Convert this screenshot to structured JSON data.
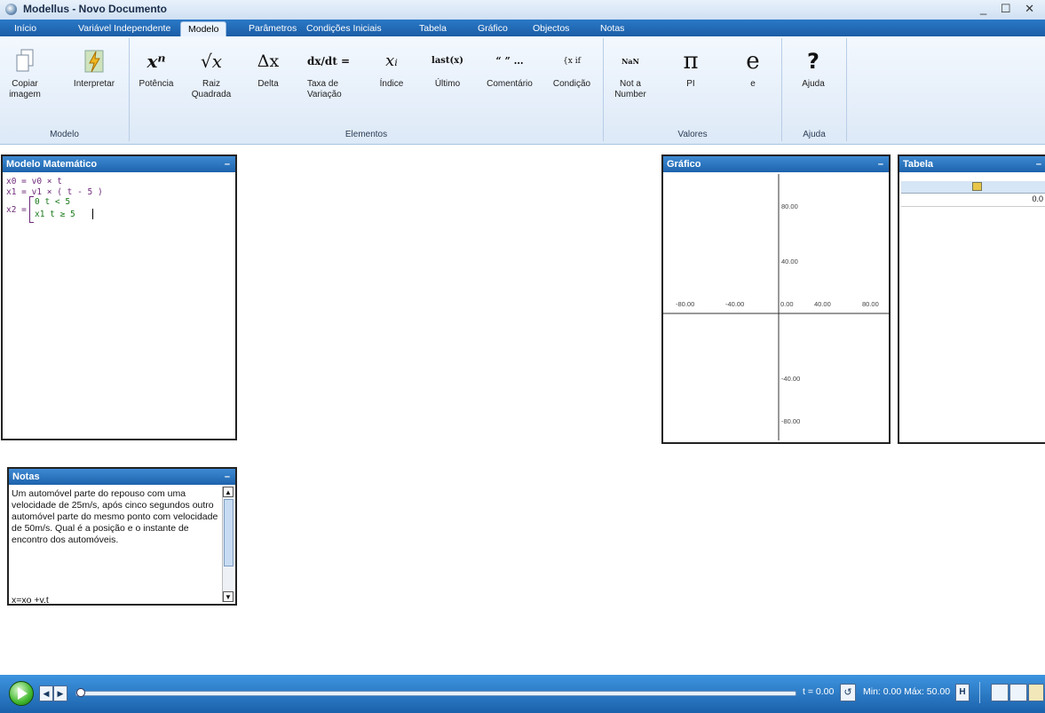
{
  "window": {
    "title": "Modellus - Novo Documento",
    "controls": "_ ☐ ✕"
  },
  "tabs": [
    "Início",
    "Variável Independente",
    "Modelo",
    "Parâmetros",
    "Condições Iniciais",
    "Tabela",
    "Gráfico",
    "Objectos",
    "Notas"
  ],
  "ribbon": {
    "modelo": {
      "label": "Modelo",
      "copiar": "Copiar imagem",
      "interpretar": "Interpretar"
    },
    "elementos": {
      "label": "Elementos",
      "potencia": "Potência",
      "raiz": "Raiz Quadrada",
      "delta": "Delta",
      "taxa": "Taxa de Variação",
      "indice": "Índice",
      "ultimo": "Último",
      "comentario": "Comentário",
      "condicao": "Condição",
      "potencia_sym": "xⁿ",
      "raiz_sym": "√x",
      "delta_sym": "Δx",
      "taxa_sym": "dx/dt =",
      "indice_sym": "xᵢ",
      "ultimo_sym": "last(x)",
      "comentario_sym": "“ ” …",
      "condicao_sym": "{x if"
    },
    "valores": {
      "label": "Valores",
      "nan": "Not a Number",
      "nan_sym": "NaN",
      "pi": "PI",
      "pi_sym": "π",
      "e": "e",
      "e_sym": "e"
    },
    "ajuda": {
      "label": "Ajuda",
      "ajuda": "Ajuda",
      "ajuda_sym": "?"
    }
  },
  "modelo_panel": {
    "title": "Modelo Matemático",
    "eq1": "x0 = v0 × t",
    "eq2": "x1 = v1 × ( t - 5 )",
    "eq3_lhs": "x2 =",
    "eq3_case1": "0  t < 5",
    "eq3_case2": "x1  t ≥ 5"
  },
  "grafico_panel": {
    "title": "Gráfico",
    "x_ticks": [
      "-80.00",
      "-40.00",
      "0.00",
      "40.00",
      "80.00"
    ],
    "y_ticks": [
      "80.00",
      "40.00",
      "-40.00",
      "-80.00"
    ]
  },
  "tabela_panel": {
    "title": "Tabela",
    "cell": "0.0"
  },
  "notas_panel": {
    "title": "Notas",
    "text": "Um automóvel parte do repouso com uma velocidade de 25m/s, após cinco segundos outro automóvel parte do mesmo ponto com velocidade de 50m/s. Qual é a posição e o instante de encontro dos automóveis.",
    "formula": "x=xo +v.t"
  },
  "bottom": {
    "t_value": "t = 0.00",
    "min_max": "Min: 0.00 Máx: 50.00",
    "progress": 0.0
  }
}
